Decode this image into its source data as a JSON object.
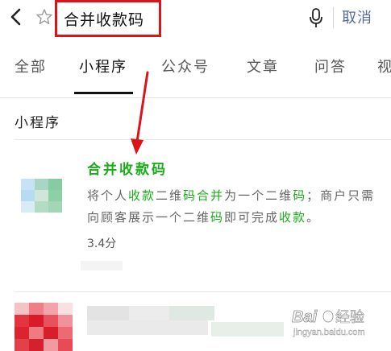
{
  "search": {
    "query": "合并收款码",
    "cancel_label": "取消"
  },
  "icons": {
    "back": "chevron-left-icon",
    "favorite": "star-icon",
    "voice": "microphone-icon"
  },
  "tabs": [
    {
      "label": "全部"
    },
    {
      "label": "小程序",
      "active": true
    },
    {
      "label": "公众号"
    },
    {
      "label": "文章"
    },
    {
      "label": "问答"
    },
    {
      "label": "视"
    }
  ],
  "section": {
    "title": "小程序"
  },
  "result": {
    "title": "合并收款码",
    "desc_parts": [
      {
        "t": "将个人",
        "hl": false
      },
      {
        "t": "收款",
        "hl": true
      },
      {
        "t": "二维",
        "hl": false
      },
      {
        "t": "码合并",
        "hl": true
      },
      {
        "t": "为一个二维",
        "hl": false
      },
      {
        "t": "码",
        "hl": true
      },
      {
        "t": "；商户只需向顾客展示一个二维",
        "hl": false
      },
      {
        "t": "码",
        "hl": true
      },
      {
        "t": "即可完成",
        "hl": false
      },
      {
        "t": "收款",
        "hl": true
      },
      {
        "t": "。",
        "hl": false
      }
    ],
    "rating": "3.4分"
  },
  "colors": {
    "highlight": "#1aad19",
    "cancel": "#576b95",
    "annotation": "#d9151a"
  },
  "watermark": {
    "brand": "Bai",
    "brand2": "经验",
    "domain": "jingyan.baidu.com"
  }
}
